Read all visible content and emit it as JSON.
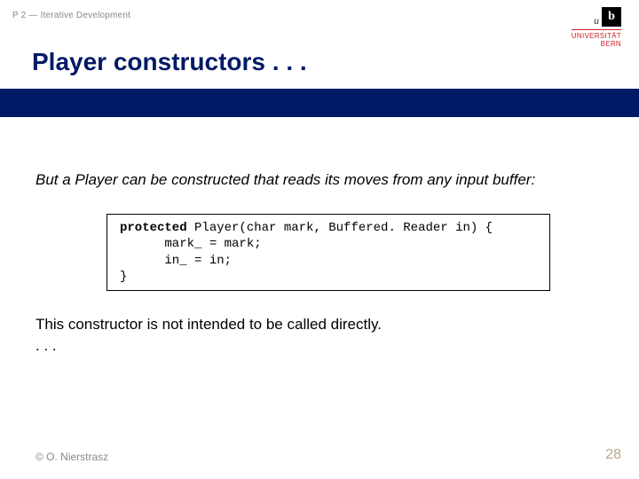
{
  "header": {
    "breadcrumb": "P 2 — Iterative Development",
    "logo": {
      "u": "u",
      "b": "b",
      "line1": "UNIVERSITÄT",
      "line2": "BERN"
    }
  },
  "title": "Player constructors . . .",
  "content": {
    "lead": "But a Player can be constructed that reads its moves from any input buffer:",
    "code": {
      "kw": "protected",
      "sig": " Player(char mark, Buffered. Reader in) {",
      "l2": "      mark_ = mark;",
      "l3": "      in_ = in;",
      "l4": "}"
    },
    "below": "This constructor is not intended to be called directly.",
    "ellipsis": ". . ."
  },
  "footer": {
    "left": "© O. Nierstrasz",
    "right": "28"
  }
}
